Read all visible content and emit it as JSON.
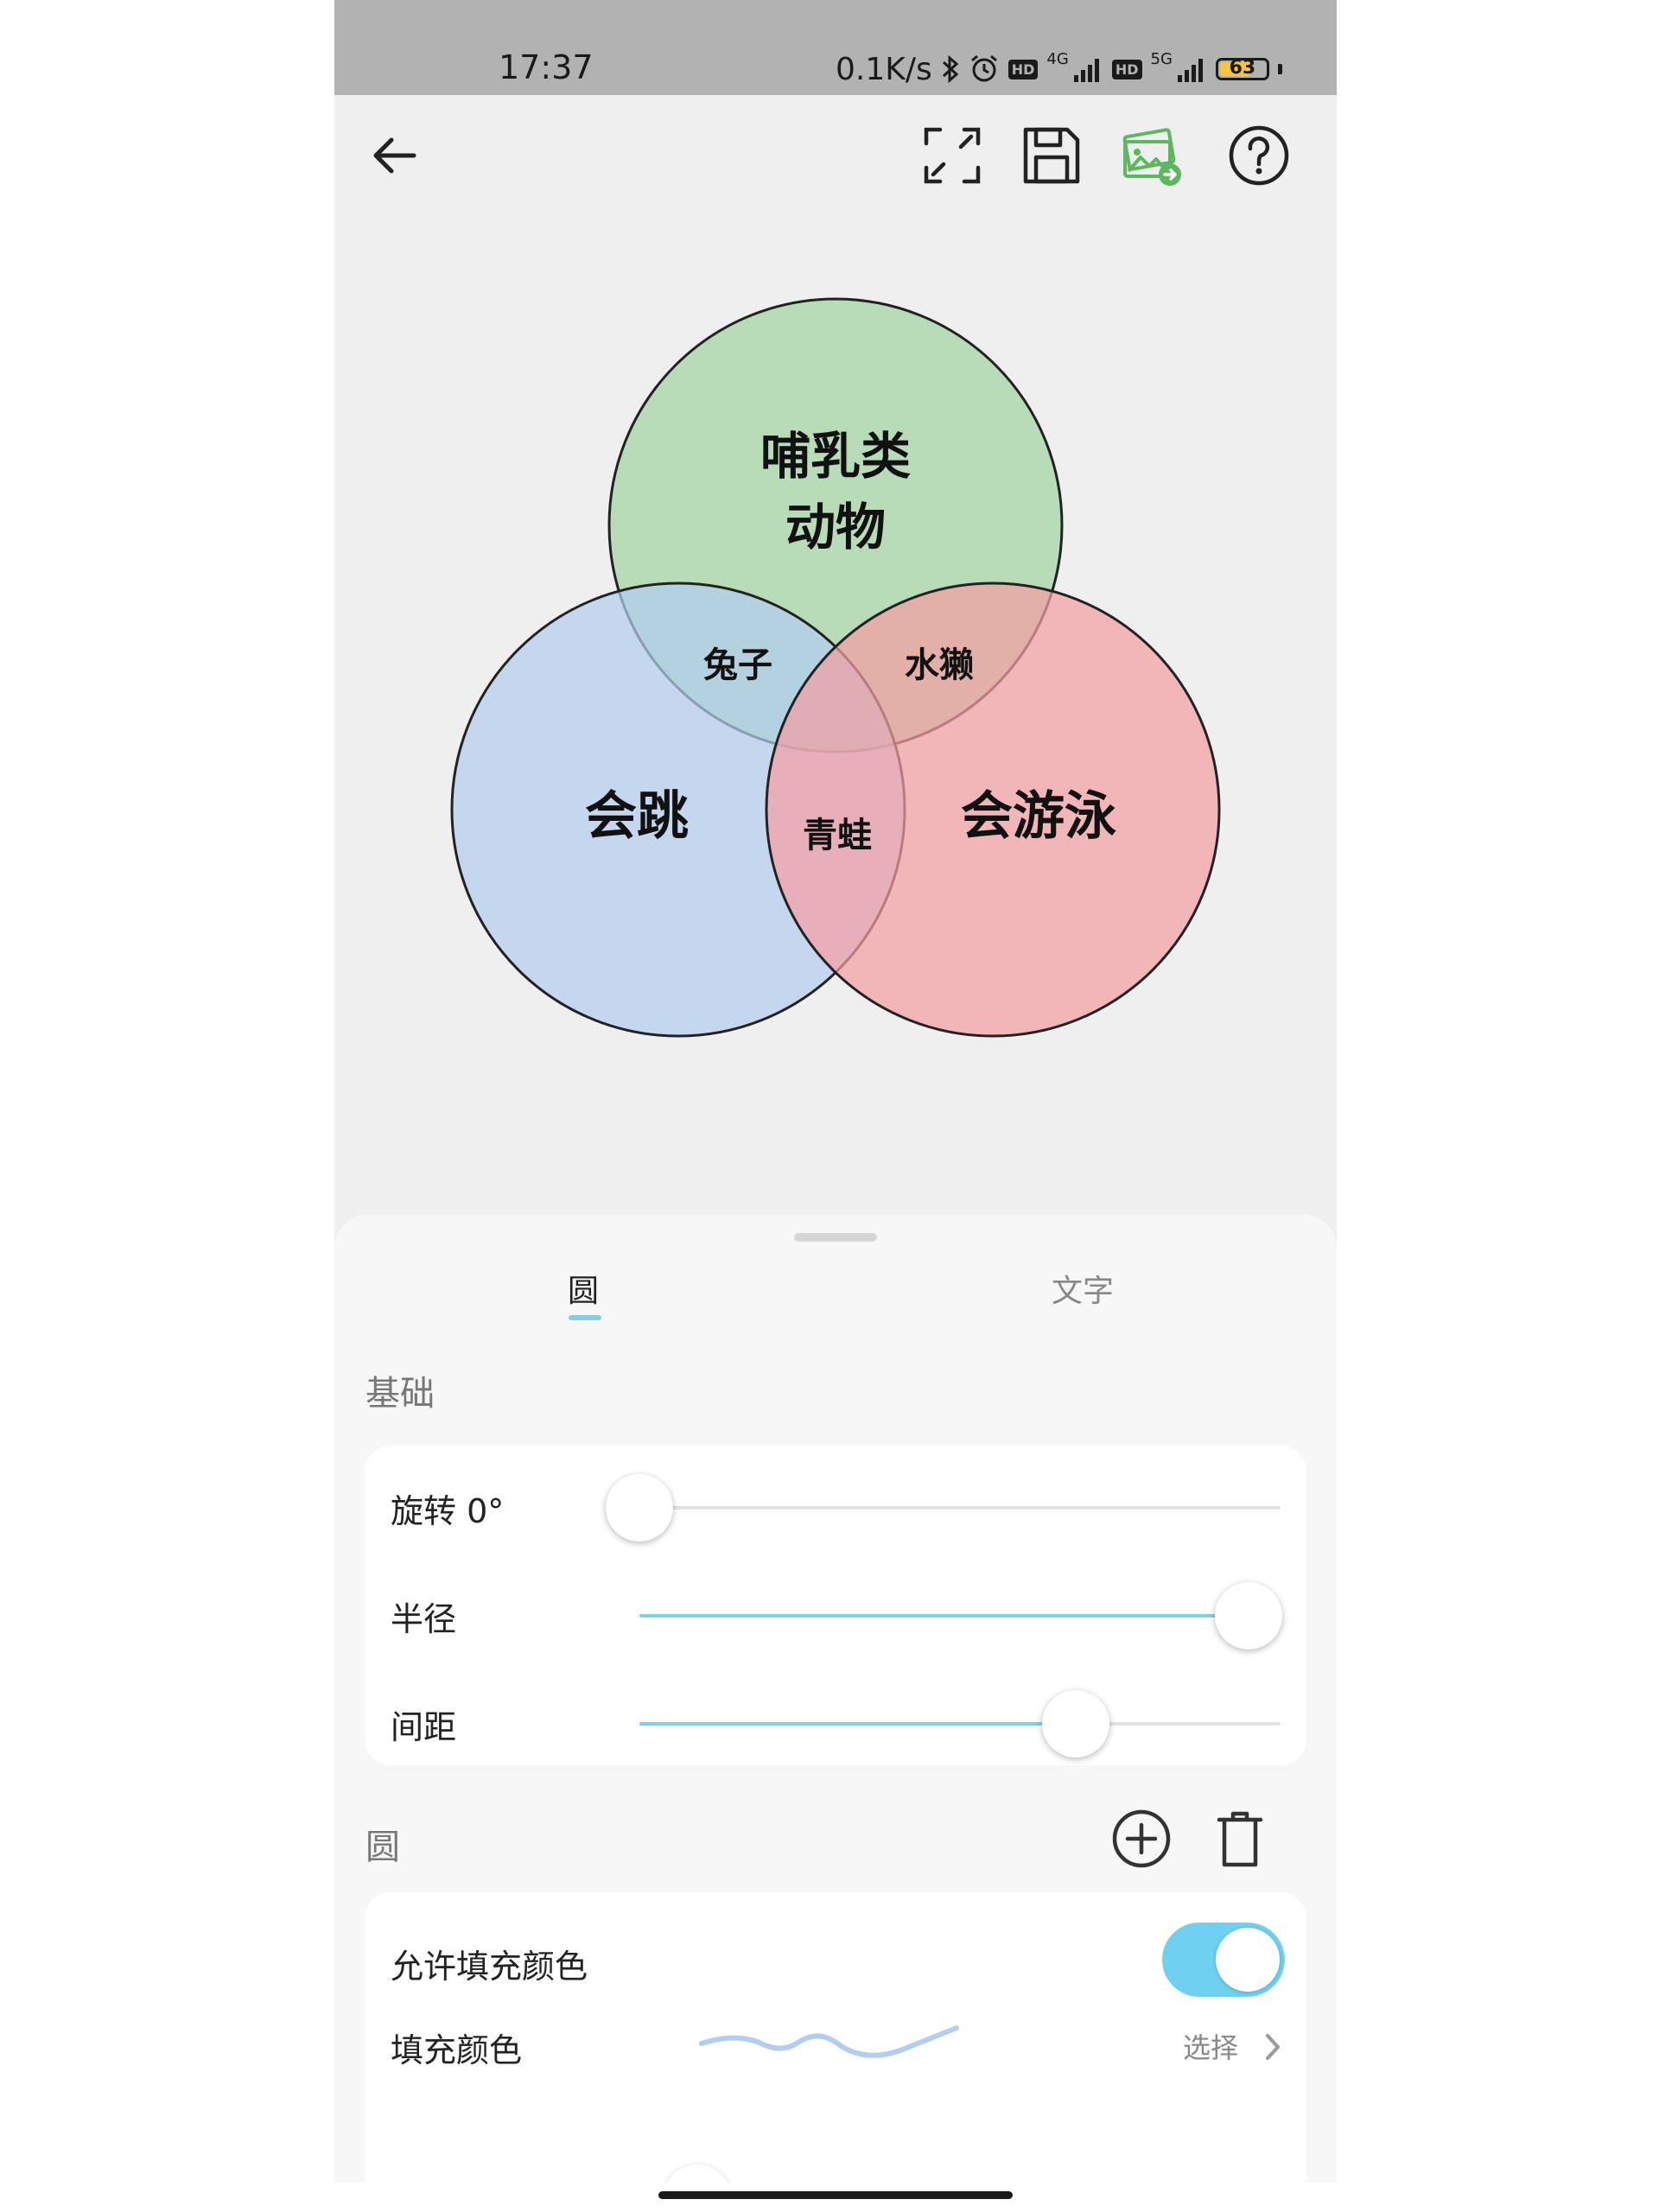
{
  "status_bar": {
    "time": "17:37",
    "net_speed": "0.1K/s",
    "hd_label": "HD",
    "network_4g": "4G",
    "network_5g": "5G",
    "battery": "63"
  },
  "toolbar": {
    "icons": [
      "back-arrow-icon",
      "fullscreen-icon",
      "save-icon",
      "export-image-icon",
      "help-icon"
    ],
    "accent_color": "#5cb85c"
  },
  "venn": {
    "circles": [
      {
        "label_line1": "哺乳类",
        "label_line2": "动物",
        "color": "#b8dcb8"
      },
      {
        "label": "会跳",
        "color": "#c7d8f0"
      },
      {
        "label": "会游泳",
        "color": "#f4b6b8"
      }
    ],
    "intersections": {
      "top_left": "兔子",
      "top_right": "水獭",
      "bottom": "青蛙"
    }
  },
  "sheet": {
    "tabs": [
      {
        "label": "圆",
        "active": true
      },
      {
        "label": "文字",
        "active": false
      }
    ],
    "basic_section": {
      "title": "基础",
      "rotation": {
        "label": "旋转 0°",
        "value": 0
      },
      "radius": {
        "label": "半径",
        "value": 0.95
      },
      "spacing": {
        "label": "间距",
        "value": 0.68
      }
    },
    "circle_section": {
      "title": "圆",
      "allow_fill": {
        "label": "允许填充颜色",
        "enabled": true
      },
      "fill_color": {
        "label": "填充颜色",
        "action": "选择"
      }
    }
  }
}
